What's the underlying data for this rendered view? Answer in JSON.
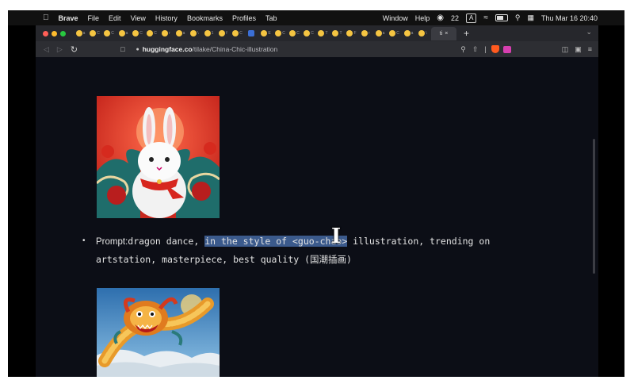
{
  "menubar": {
    "app_name": "Brave",
    "items": [
      "File",
      "Edit",
      "View",
      "History",
      "Bookmarks",
      "Profiles",
      "Tab"
    ],
    "window": "Window",
    "help": "Help",
    "wechat_count": "22",
    "input_source": "A",
    "datetime": "Thu Mar 16  20:40"
  },
  "browser": {
    "url_host": "huggingface.co",
    "url_path": "/tilake/China-Chic-illustration",
    "tab_letters": [
      "a",
      "C",
      "C",
      "a",
      "C",
      "C",
      "r",
      "a",
      "\\",
      "1",
      "f",
      "C",
      "",
      "E",
      "C",
      "C",
      "C",
      "T",
      "T",
      "F",
      "r",
      "a",
      "C",
      "a",
      "\\"
    ],
    "active_tab_label": "ti",
    "active_tab_close": "×",
    "new_tab": "+"
  },
  "content": {
    "prompt_label": "Prompt:",
    "prompt_before": "dragon dance, ",
    "prompt_selected": "in the style of <guo-cha",
    "prompt_hidden": "o>",
    "prompt_after": " illustration, trending on",
    "prompt_line2": "artstation, masterpiece, best quality (国潮插画)",
    "bullet": "•"
  },
  "colors": {
    "page_bg": "#0c0e16",
    "selection": "#3b5a8c",
    "traffic_red": "#ff5f57",
    "traffic_yellow": "#febc2e",
    "traffic_green": "#28c840"
  }
}
